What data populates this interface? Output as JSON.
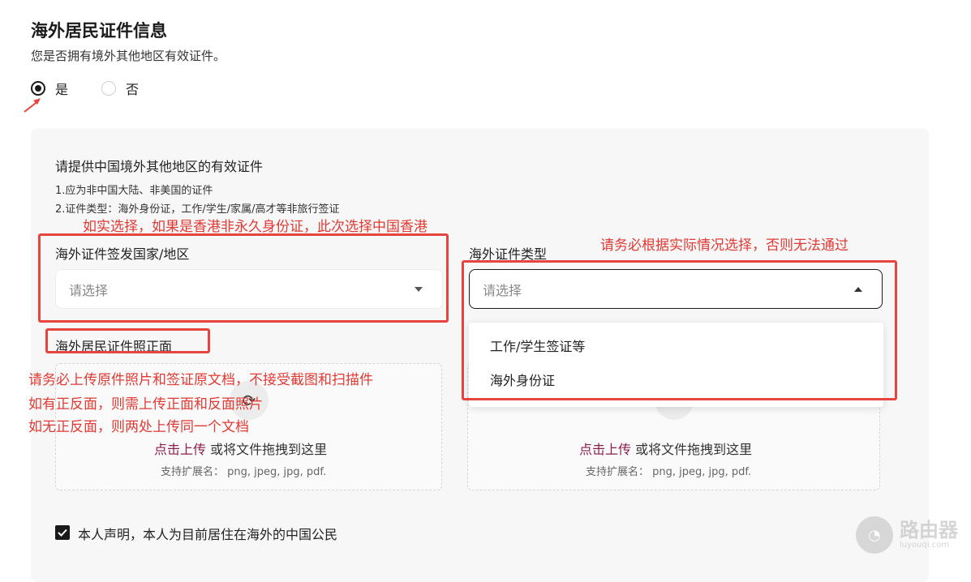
{
  "section": {
    "title": "海外居民证件信息",
    "question": "您是否拥有境外其他地区有效证件。",
    "radio_yes": "是",
    "radio_no": "否"
  },
  "panel": {
    "heading": "请提供中国境外其他地区的有效证件",
    "note1": "1.应为非中国大陆、非美国的证件",
    "note2": "2.证件类型：海外身份证，工作/学生/家属/高才等非旅行签证"
  },
  "fields": {
    "country_label": "海外证件签发国家/地区",
    "country_placeholder": "请选择",
    "type_label": "海外证件类型",
    "type_placeholder": "请选择",
    "type_options": [
      "工作/学生签证等",
      "海外身份证"
    ]
  },
  "upload": {
    "front_label": "海外居民证件照正面",
    "link_text": "点击上传",
    "drag_text": " 或将文件拖拽到这里",
    "ext_text": "支持扩展名： png, jpeg, jpg, pdf."
  },
  "declaration": {
    "text": "本人声明，本人为目前居住在海外的中国公民"
  },
  "annotations": {
    "country_hint": "如实选择，如果是香港非永久身份证，此次选择中国香港",
    "type_hint": "请务必根据实际情况选择，否则无法通过",
    "upload_hint_1": "请务必上传原件照片和签证原文档，不接受截图和扫描件",
    "upload_hint_2": "如有正反面，则需上传正面和反面照片",
    "upload_hint_3": "如无正反面，则两处上传同一个文档"
  },
  "watermark": {
    "name": "路由器",
    "url": "luyouqi.com"
  },
  "colors": {
    "annotation_red": "#e5443f",
    "link_color": "#8b1e4d",
    "panel_bg": "#f7f7f7"
  }
}
